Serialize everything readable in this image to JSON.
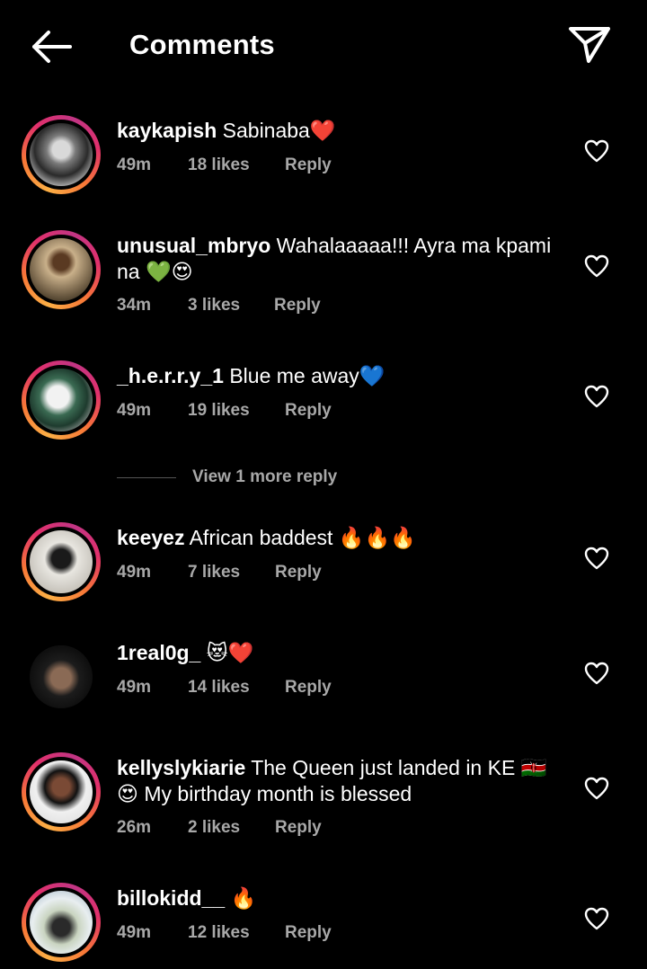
{
  "header": {
    "title": "Comments",
    "back_icon": "back-arrow-icon",
    "share_icon": "paper-plane-icon"
  },
  "comments": [
    {
      "user": "kaykapish",
      "text": "Sabinaba❤️",
      "time": "49m",
      "likes": "18 likes",
      "reply": "Reply"
    },
    {
      "user": "unusual_mbryo",
      "text": "Wahalaaaaa!!! Ayra ma kpami na 💚😍",
      "time": "34m",
      "likes": "3 likes",
      "reply": "Reply"
    },
    {
      "user": "_h.e.r.r.y_1",
      "text": "Blue me away💙",
      "time": "49m",
      "likes": "19 likes",
      "reply": "Reply"
    },
    {
      "user": "keeyez",
      "text": "African baddest 🔥🔥🔥",
      "time": "49m",
      "likes": "7 likes",
      "reply": "Reply"
    },
    {
      "user": "1real0g_",
      "text": "😻❤️",
      "time": "49m",
      "likes": "14 likes",
      "reply": "Reply"
    },
    {
      "user": "kellyslykiarie",
      "text": "The Queen just landed in KE 🇰🇪 😍 My birthday month is blessed",
      "time": "26m",
      "likes": "2 likes",
      "reply": "Reply"
    },
    {
      "user": "billokidd__",
      "text": "🔥",
      "time": "49m",
      "likes": "12 likes",
      "reply": "Reply"
    }
  ],
  "view_more": "View 1 more reply",
  "colors": {
    "background": "#000000",
    "meta": "#a8a8a8",
    "ring_start": "#fcaf45",
    "ring_end": "#c13584"
  }
}
